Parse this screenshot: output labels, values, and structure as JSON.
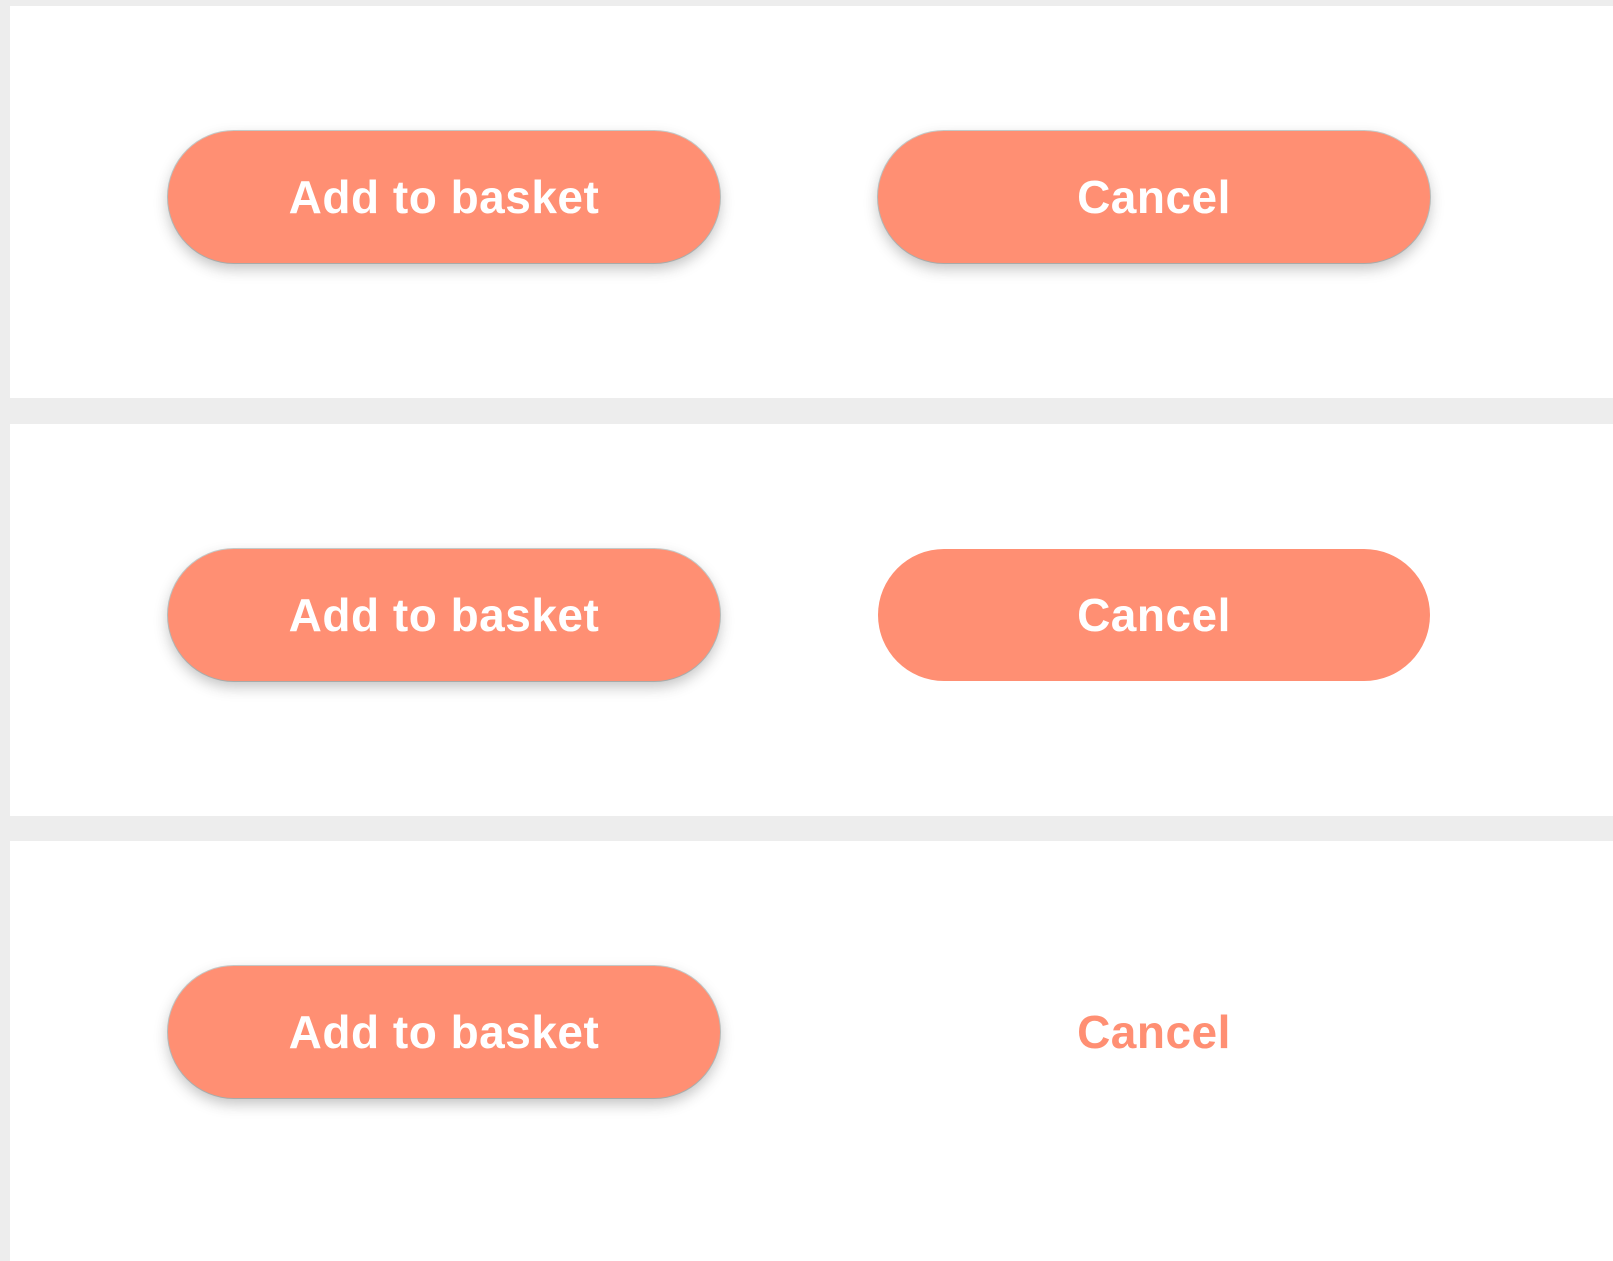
{
  "colors": {
    "page_background": "#ededed",
    "panel_background": "#ffffff",
    "accent": "#ff8f73",
    "button_text": "#ffffff"
  },
  "rows": [
    {
      "primary_label": "Add to basket",
      "secondary_label": "Cancel",
      "secondary_style": "raised"
    },
    {
      "primary_label": "Add to basket",
      "secondary_label": "Cancel",
      "secondary_style": "flat"
    },
    {
      "primary_label": "Add to basket",
      "secondary_label": "Cancel",
      "secondary_style": "text"
    }
  ]
}
